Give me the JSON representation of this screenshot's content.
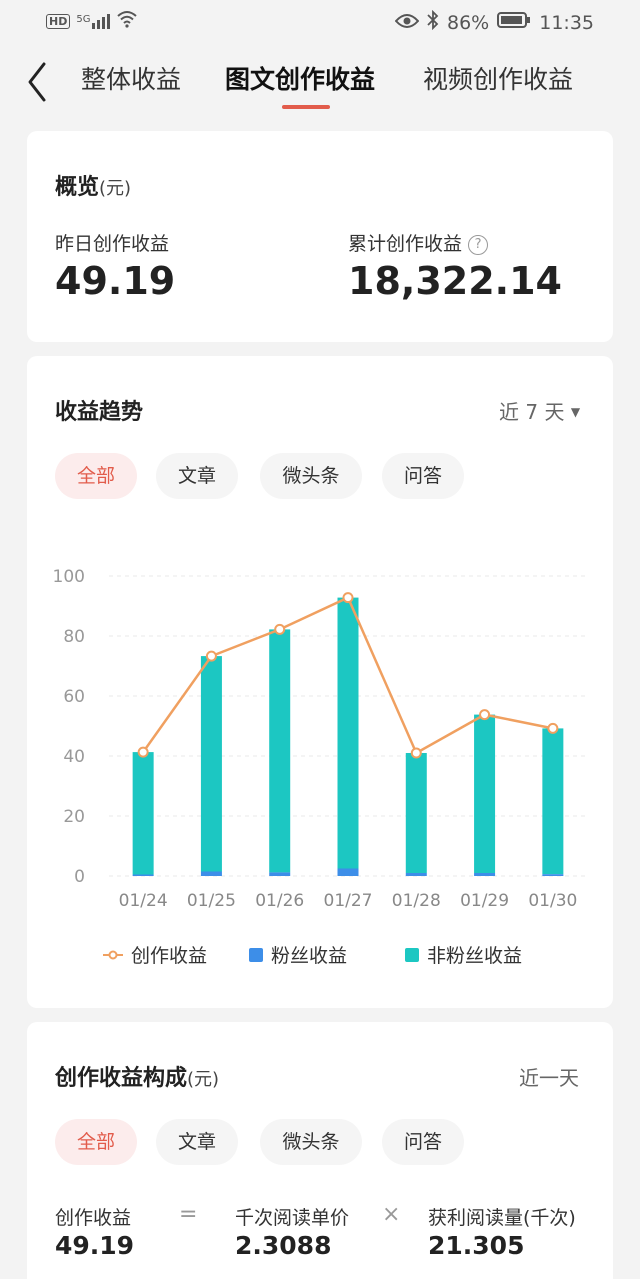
{
  "status_bar": {
    "hd": "HD",
    "signal": "5G",
    "battery": "86%",
    "time": "11:35"
  },
  "nav": {
    "tabs": [
      "整体收益",
      "图文创作收益",
      "视频创作收益"
    ],
    "active_tab": 1
  },
  "overview": {
    "title": "概览",
    "unit": "(元)",
    "yesterday_label": "昨日创作收益",
    "yesterday_value": "49.19",
    "total_label": "累计创作收益",
    "total_value": "18,322.14"
  },
  "trend": {
    "title": "收益趋势",
    "period": "近 7 天",
    "chips": [
      "全部",
      "文章",
      "微头条",
      "问答"
    ],
    "active_chip": 0,
    "legend": {
      "line": "创作收益",
      "fan": "粉丝收益",
      "nonfan": "非粉丝收益"
    }
  },
  "chart_data": {
    "type": "bar",
    "categories": [
      "01/24",
      "01/25",
      "01/26",
      "01/27",
      "01/28",
      "01/29",
      "01/30"
    ],
    "series": [
      {
        "name": "粉丝收益",
        "kind": "stacked-bar",
        "color": "#3d8ee8",
        "values": [
          0.5,
          1.5,
          1.2,
          2.5,
          1.0,
          1.0,
          0.6
        ]
      },
      {
        "name": "非粉丝收益",
        "kind": "stacked-bar",
        "color": "#1cc7c2",
        "values": [
          40.8,
          71.8,
          81.0,
          90.3,
          40.0,
          52.8,
          48.6
        ]
      },
      {
        "name": "创作收益",
        "kind": "line",
        "color": "#f0a060",
        "values": [
          41.3,
          73.3,
          82.2,
          92.8,
          41.0,
          53.8,
          49.2
        ]
      }
    ],
    "yticks": [
      0,
      20,
      40,
      60,
      80,
      100
    ],
    "ylim": [
      0,
      100
    ],
    "grid": true,
    "legend": "bottom"
  },
  "composition": {
    "title": "创作收益构成",
    "unit": "(元)",
    "period": "近一天",
    "chips": [
      "全部",
      "文章",
      "微头条",
      "问答"
    ],
    "active_chip": 0,
    "formula": {
      "a_label": "创作收益",
      "a_value": "49.19",
      "eq": "=",
      "b_label": "千次阅读单价",
      "b_value": "2.3088",
      "times": "×",
      "c_label": "获利阅读量(千次)",
      "c_value": "21.305"
    }
  },
  "colors": {
    "accent": "#e25c4b",
    "fan": "#3d8ee8",
    "nonfan": "#1cc7c2",
    "line": "#f0a060"
  }
}
